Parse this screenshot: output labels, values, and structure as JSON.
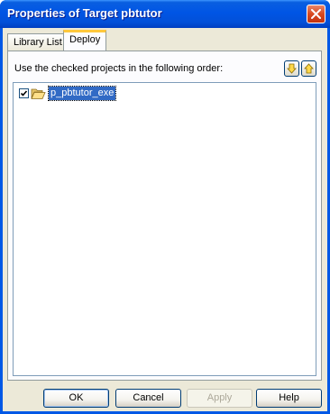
{
  "window": {
    "title": "Properties of Target pbtutor",
    "close_icon": "close-icon"
  },
  "tabs": [
    {
      "label": "Library List",
      "active": false
    },
    {
      "label": "Deploy",
      "active": true
    }
  ],
  "deploy": {
    "instruction": "Use the checked projects in the following order:",
    "move_down_icon": "arrow-down-icon",
    "move_up_icon": "arrow-up-icon",
    "projects": [
      {
        "label": "p_pbtutor_exe",
        "checked": true,
        "selected": true,
        "icon": "folder-open-icon"
      }
    ]
  },
  "buttons": {
    "ok": "OK",
    "cancel": "Cancel",
    "apply": "Apply",
    "help": "Help"
  },
  "colors": {
    "titlebar": "#0055e5",
    "selection": "#316ac5",
    "dialog_bg": "#ece9d8"
  }
}
